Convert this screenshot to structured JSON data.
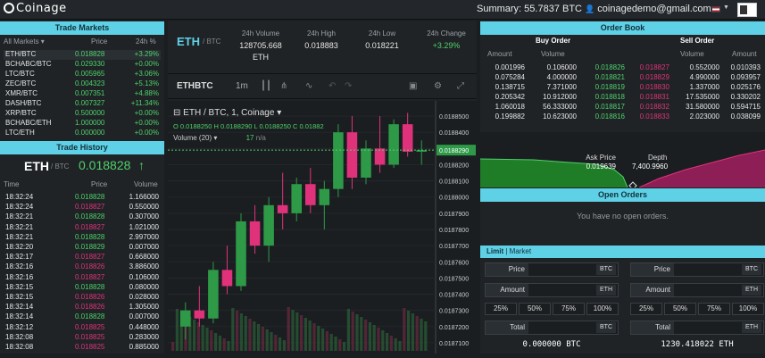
{
  "app": {
    "logo": "Coinage",
    "summary": "Summary: 55.7837 BTC",
    "user": "coinagedemo@gmail.com"
  },
  "markets": {
    "title": "Trade Markets",
    "headers": [
      "All Markets ▾",
      "Price",
      "24h %"
    ],
    "rows": [
      {
        "pair": "ETH/BTC",
        "price": "0.018828",
        "change": "+3.29%",
        "dir": "up"
      },
      {
        "pair": "BCHABC/BTC",
        "price": "0.029330",
        "change": "+0.00%",
        "dir": "up"
      },
      {
        "pair": "LTC/BTC",
        "price": "0.005965",
        "change": "+3.06%",
        "dir": "up"
      },
      {
        "pair": "ZEC/BTC",
        "price": "0.004323",
        "change": "+5.13%",
        "dir": "up"
      },
      {
        "pair": "XMR/BTC",
        "price": "0.007351",
        "change": "+4.88%",
        "dir": "up"
      },
      {
        "pair": "DASH/BTC",
        "price": "0.007327",
        "change": "+11.34%",
        "dir": "up"
      },
      {
        "pair": "XRP/BTC",
        "price": "0.500000",
        "change": "+0.00%",
        "dir": "up"
      },
      {
        "pair": "BCHABC/ETH",
        "price": "1.000000",
        "change": "+0.00%",
        "dir": "up"
      },
      {
        "pair": "LTC/ETH",
        "price": "0.000000",
        "change": "+0.00%",
        "dir": "up"
      }
    ]
  },
  "history": {
    "title": "Trade History",
    "pair": "ETH",
    "quote": "/ BTC",
    "last": "0.018828",
    "arrow": "↑",
    "headers": [
      "Time",
      "Price",
      "Volume"
    ],
    "rows": [
      {
        "time": "18:32:24",
        "price": "0.018828",
        "vol": "1.166000",
        "dir": "up"
      },
      {
        "time": "18:32:24",
        "price": "0.018827",
        "vol": "0.550000",
        "dir": "down"
      },
      {
        "time": "18:32:21",
        "price": "0.018828",
        "vol": "0.307000",
        "dir": "up"
      },
      {
        "time": "18:32:21",
        "price": "0.018827",
        "vol": "1.021000",
        "dir": "down"
      },
      {
        "time": "18:32:21",
        "price": "0.018828",
        "vol": "2.997000",
        "dir": "up"
      },
      {
        "time": "18:32:20",
        "price": "0.018829",
        "vol": "0.007000",
        "dir": "up"
      },
      {
        "time": "18:32:17",
        "price": "0.018827",
        "vol": "0.668000",
        "dir": "down"
      },
      {
        "time": "18:32:16",
        "price": "0.018826",
        "vol": "3.886000",
        "dir": "down"
      },
      {
        "time": "18:32:16",
        "price": "0.018827",
        "vol": "0.106000",
        "dir": "down"
      },
      {
        "time": "18:32:15",
        "price": "0.018828",
        "vol": "0.080000",
        "dir": "up"
      },
      {
        "time": "18:32:15",
        "price": "0.018826",
        "vol": "0.028000",
        "dir": "down"
      },
      {
        "time": "18:32:14",
        "price": "0.018826",
        "vol": "1.305000",
        "dir": "down"
      },
      {
        "time": "18:32:14",
        "price": "0.018828",
        "vol": "0.007000",
        "dir": "up"
      },
      {
        "time": "18:32:12",
        "price": "0.018825",
        "vol": "0.448000",
        "dir": "down"
      },
      {
        "time": "18:32:08",
        "price": "0.018825",
        "vol": "0.283000",
        "dir": "down"
      },
      {
        "time": "18:32:08",
        "price": "0.018825",
        "vol": "0.885000",
        "dir": "down"
      }
    ]
  },
  "ticker": {
    "pair": "ETH",
    "quote": "/ BTC",
    "vol_label": "24h Volume",
    "vol": "128705.668",
    "vol_unit": "ETH",
    "high_label": "24h High",
    "high": "0.018883",
    "low_label": "24h Low",
    "low": "0.018221",
    "chg_label": "24h Change",
    "chg": "+3.29%"
  },
  "chart": {
    "symbol": "ETHBTC",
    "interval": "1m",
    "legend": "ETH / BTC, 1, Coinage",
    "ohlc": "O 0.0188250 H 0.0188290 L 0.0188250 C 0.01882",
    "volume": "Volume (20)",
    "volume_val": "17",
    "volume_na": "n/a",
    "last_price": "0.0188290",
    "ticks": [
      "0.0188500",
      "0.0188400",
      "0.0188300",
      "0.0188200",
      "0.0188100",
      "0.0188000",
      "0.0187900",
      "0.0187800",
      "0.0187700",
      "0.0187600",
      "0.0187500",
      "0.0187400",
      "0.0187300",
      "0.0187200",
      "0.0187100"
    ]
  },
  "chart_data": {
    "type": "candlestick",
    "title": "ETH / BTC, 1, Coinage",
    "ylim": [
      0.018705,
      0.018855
    ],
    "candles": [
      [
        0.01872,
        0.018735,
        0.018712,
        0.01873
      ],
      [
        0.01873,
        0.018745,
        0.01872,
        0.018725
      ],
      [
        0.018725,
        0.01876,
        0.018722,
        0.018755
      ],
      [
        0.018755,
        0.01877,
        0.01874,
        0.018745
      ],
      [
        0.018745,
        0.01879,
        0.018742,
        0.018785
      ],
      [
        0.018785,
        0.018795,
        0.018765,
        0.01877
      ],
      [
        0.01877,
        0.0188,
        0.01876,
        0.018795
      ],
      [
        0.018795,
        0.018815,
        0.01878,
        0.01879
      ],
      [
        0.01879,
        0.018812,
        0.018785,
        0.018808
      ],
      [
        0.018808,
        0.018818,
        0.01879,
        0.018795
      ],
      [
        0.018795,
        0.01881,
        0.01878,
        0.018805
      ],
      [
        0.018805,
        0.018845,
        0.0188,
        0.01884
      ],
      [
        0.01884,
        0.01885,
        0.018805,
        0.018812
      ],
      [
        0.018812,
        0.018835,
        0.018808,
        0.01883
      ],
      [
        0.01883,
        0.01885,
        0.018815,
        0.01882
      ],
      [
        0.01882,
        0.018848,
        0.018818,
        0.018845
      ],
      [
        0.018845,
        0.018852,
        0.018825,
        0.018828
      ],
      [
        0.018828,
        0.018835,
        0.01882,
        0.018829
      ]
    ]
  },
  "orderbook": {
    "title": "Order Book",
    "buy_title": "Buy Order",
    "sell_title": "Sell Order",
    "headers": [
      "Amount",
      "Volume",
      "Volume",
      "Amount"
    ],
    "rows": [
      [
        "0.001996",
        "0.106000",
        "0.018826",
        "0.018827",
        "0.552000",
        "0.010393"
      ],
      [
        "0.075284",
        "4.000000",
        "0.018821",
        "0.018829",
        "4.990000",
        "0.093957"
      ],
      [
        "0.138715",
        "7.371000",
        "0.018819",
        "0.018830",
        "1.337000",
        "0.025176"
      ],
      [
        "0.205342",
        "10.912000",
        "0.018818",
        "0.018831",
        "17.535000",
        "0.330202"
      ],
      [
        "1.060018",
        "56.333000",
        "0.018817",
        "0.018832",
        "31.580000",
        "0.594715"
      ],
      [
        "0.199882",
        "10.623000",
        "0.018816",
        "0.018833",
        "2.023000",
        "0.038099"
      ]
    ]
  },
  "depth": {
    "ask_label": "Ask Price",
    "ask": "0.019639",
    "depth_label": "Depth",
    "depth": "7,400.9960"
  },
  "open_orders": {
    "title": "Open Orders",
    "empty": "You have no open orders."
  },
  "trade": {
    "tab_limit": "Limit",
    "tab_market": "Market",
    "price_label": "Price",
    "amount_label": "Amount",
    "total_label": "Total",
    "btc": "BTC",
    "eth": "ETH",
    "pcts": [
      "25%",
      "50%",
      "75%",
      "100%"
    ],
    "buy_total": "0.000000 BTC",
    "sell_total": "1230.418022 ETH"
  }
}
